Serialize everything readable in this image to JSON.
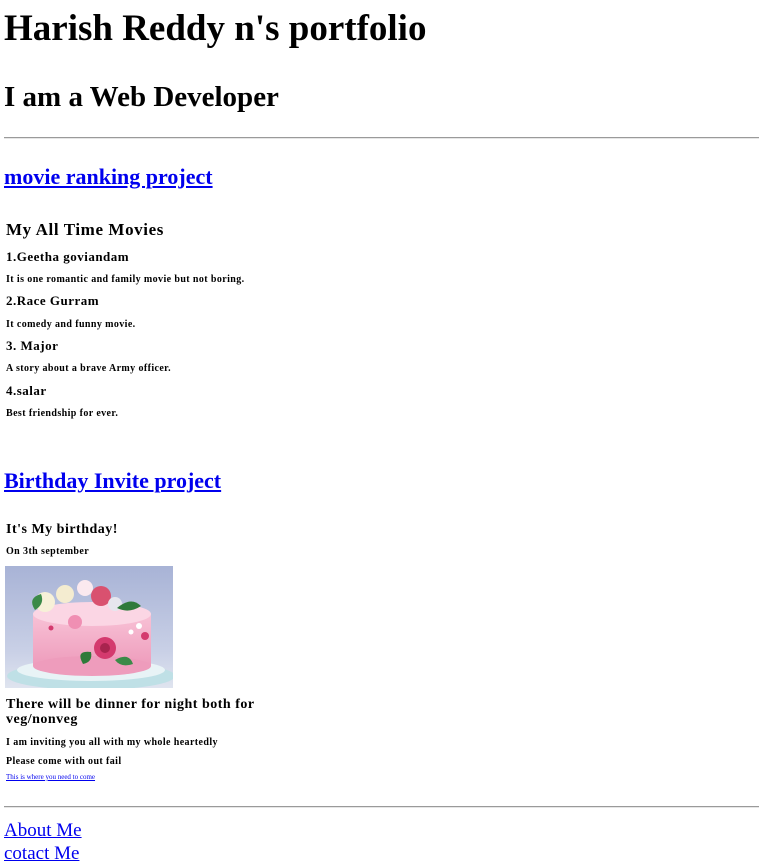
{
  "header": {
    "title": "Harish Reddy n's portfolio",
    "subtitle": "I am a Web Developer"
  },
  "movie_project": {
    "link": "movie ranking project",
    "heading": "My All Time Movies",
    "items": [
      {
        "title": "1.Geetha goviandam",
        "desc": "It is one romantic and family movie but not boring."
      },
      {
        "title": "2.Race Gurram",
        "desc": "It comedy and funny movie."
      },
      {
        "title": "3. Major",
        "desc": "A story about a brave Army officer."
      },
      {
        "title": "4.salar",
        "desc": "Best friendship for ever."
      }
    ]
  },
  "birthday_project": {
    "link": "Birthday Invite project",
    "heading": "It's My birthday!",
    "date": "On 3th september",
    "dinner": "There will be dinner for night both for veg/nonveg",
    "invite": "I am inviting you all with my whole heartedly",
    "request": "Please come with out fail",
    "location_link": "This is where you need to come"
  },
  "footer": {
    "about": "About Me",
    "contact": "cotact Me"
  },
  "colors": {
    "link": "#0000ee",
    "rule": "#9a9a9a",
    "cake_pink": "#f2a7c3",
    "rose": "#d43a6e",
    "leaf": "#2f7a3a",
    "plate_bg": "#a7b2d4"
  }
}
